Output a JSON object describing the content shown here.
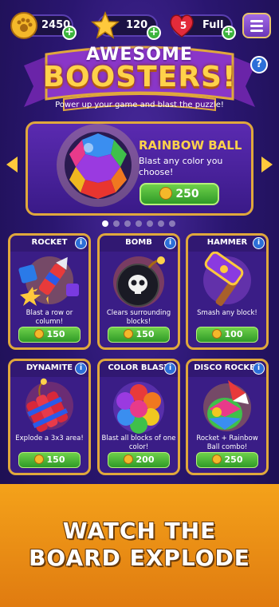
{
  "resources": {
    "paws": "2450",
    "stars": "120",
    "lives_count": "5",
    "lives_status": "Full"
  },
  "banner": {
    "line1": "AWESOME",
    "line2": "BOOSTERS!",
    "subtitle": "Power up your game and blast the puzzle!",
    "help": "?"
  },
  "featured": {
    "name": "RAINBOW BALL",
    "description": "Blast any color you choose!",
    "price": "250"
  },
  "pager": {
    "total": 7,
    "active": 0
  },
  "boosters": [
    {
      "name": "ROCKET",
      "description": "Blast a row or column!",
      "price": "150",
      "icon": "rocket-icon"
    },
    {
      "name": "BOMB",
      "description": "Clears surrounding blocks!",
      "price": "150",
      "icon": "bomb-icon"
    },
    {
      "name": "HAMMER",
      "description": "Smash any block!",
      "price": "100",
      "icon": "hammer-icon"
    },
    {
      "name": "DYNAMITE",
      "description": "Explode a 3x3 area!",
      "price": "150",
      "icon": "dynamite-icon"
    },
    {
      "name": "COLOR BLAST",
      "description": "Blast all blocks of one color!",
      "price": "200",
      "icon": "color-blast-icon"
    },
    {
      "name": "DISCO ROCKET",
      "description": "Rocket + Rainbow Ball combo!",
      "price": "250",
      "icon": "disco-rocket-icon"
    }
  ],
  "info_glyph": "i",
  "plus_glyph": "+",
  "tagline": {
    "line1": "WATCH THE",
    "line2": "BOARD EXPLODE"
  },
  "colors": {
    "accent_gold": "#ffd24a",
    "button_green": "#3cb43c",
    "frame_gold": "#e0a83c",
    "bg_purple": "#2a1670",
    "band_orange": "#f4a21a"
  }
}
